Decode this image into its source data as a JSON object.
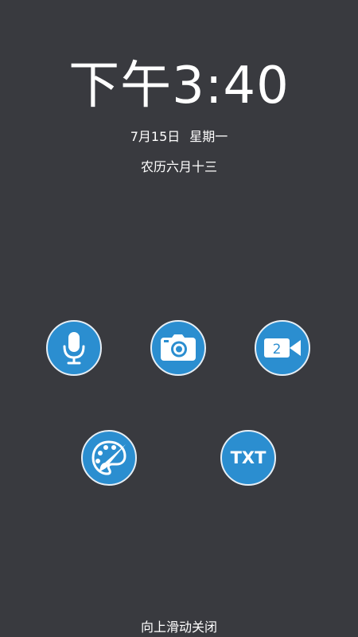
{
  "lockscreen": {
    "time": "下午3:40",
    "date": "7月15日",
    "weekday": "星期一",
    "lunar_date": "农历六月十三",
    "swipe_hint": "向上滑动关闭"
  },
  "actions": [
    {
      "id": "voice",
      "icon": "microphone-icon"
    },
    {
      "id": "photo",
      "icon": "camera-icon"
    },
    {
      "id": "video",
      "icon": "video-camera-icon",
      "badge": "2"
    },
    {
      "id": "paint",
      "icon": "paint-palette-icon"
    },
    {
      "id": "text",
      "icon": "txt-icon",
      "label": "TXT"
    }
  ],
  "colors": {
    "background": "#393a3f",
    "button_fill": "#2b8ed0",
    "button_border": "#e6eef5",
    "text": "#ffffff"
  }
}
